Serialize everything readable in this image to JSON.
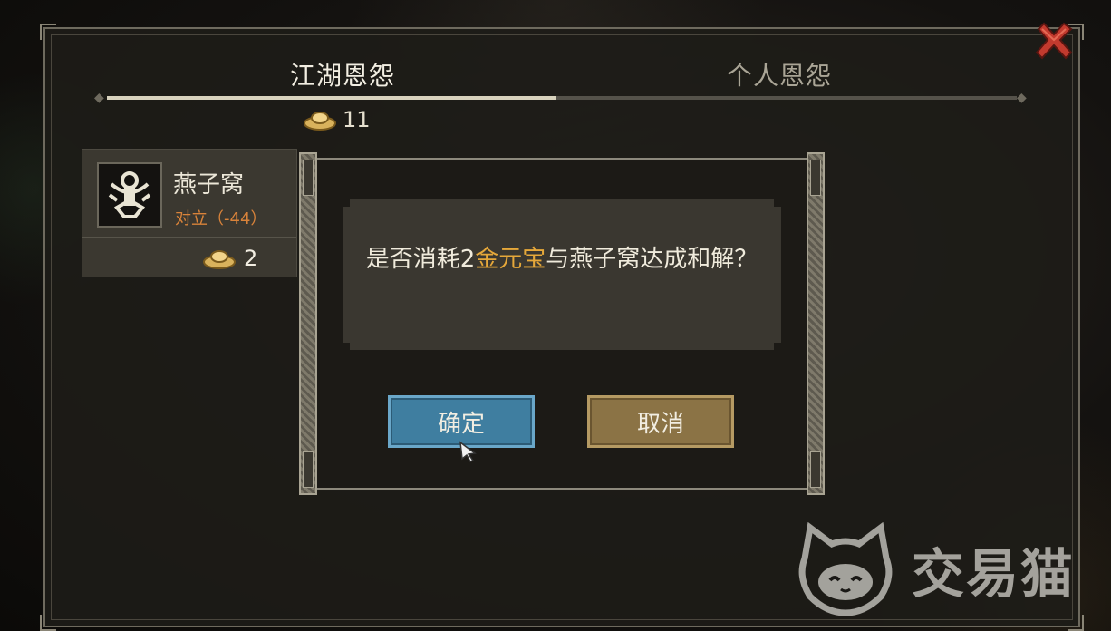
{
  "tabs": [
    {
      "label": "江湖恩怨",
      "active": true
    },
    {
      "label": "个人恩怨",
      "active": false
    }
  ],
  "currency": {
    "icon": "gold-ingot-icon",
    "amount": "11"
  },
  "list": {
    "items": [
      {
        "name": "燕子窝",
        "relation": "对立（-44）",
        "cost": "2",
        "cost_icon": "gold-ingot-icon",
        "avatar_icon": "faction-emblem-icon"
      }
    ]
  },
  "dialog": {
    "message_before": "是否消耗2",
    "message_highlight": "金元宝",
    "message_after": "与燕子窝达成和解？",
    "highlight_color": "#e6a83a",
    "confirm_label": "确定",
    "cancel_label": "取消"
  },
  "watermark": {
    "text": "交易猫"
  },
  "colors": {
    "confirm_button": "#3f7ea0",
    "cancel_button": "#8b7345",
    "relation_text": "#d9833a",
    "close_icon": "#c0392b"
  }
}
